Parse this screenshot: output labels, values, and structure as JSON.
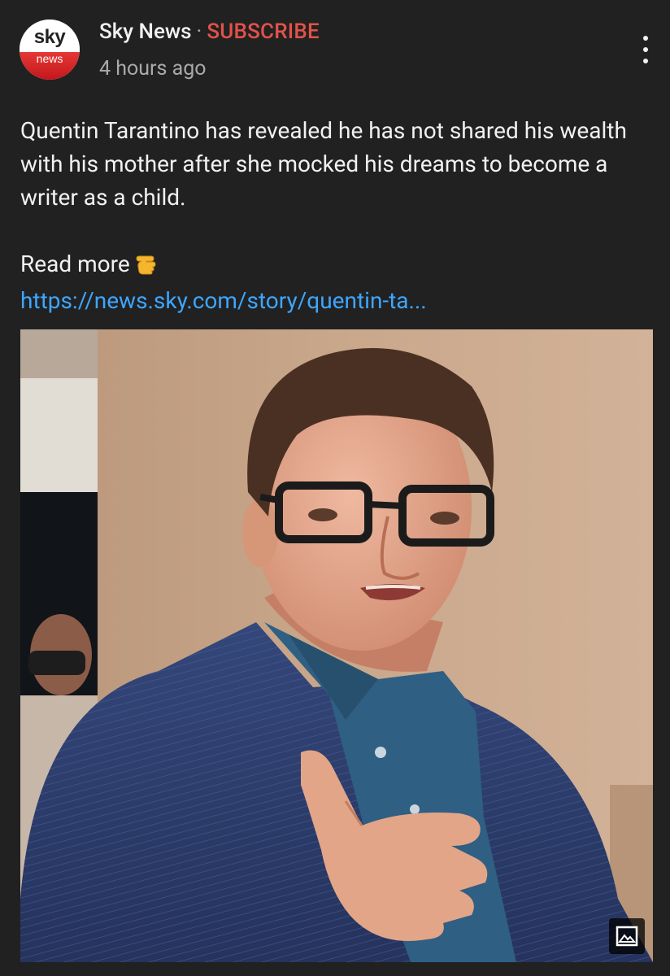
{
  "channel": {
    "logo_top": "sky",
    "logo_bottom": "news",
    "name": "Sky News",
    "separator": "·",
    "subscribe_label": "SUBSCRIBE",
    "timestamp": "4 hours ago"
  },
  "post": {
    "text": "Quentin Tarantino has revealed he has not shared his wealth with his mother after she mocked his dreams to become a writer as a child.",
    "read_more": "Read more",
    "link": "https://news.sky.com/story/quentin-ta..."
  },
  "icons": {
    "menu": "more-vert-icon",
    "finger": "backhand-index-pointing-left-icon",
    "image_badge": "image-icon"
  },
  "colors": {
    "background": "#212121",
    "text": "#f1f1f1",
    "secondary": "#aaaaaa",
    "subscribe": "#e3524b",
    "link": "#3ea6ff",
    "brand_red": "#d71d24"
  }
}
